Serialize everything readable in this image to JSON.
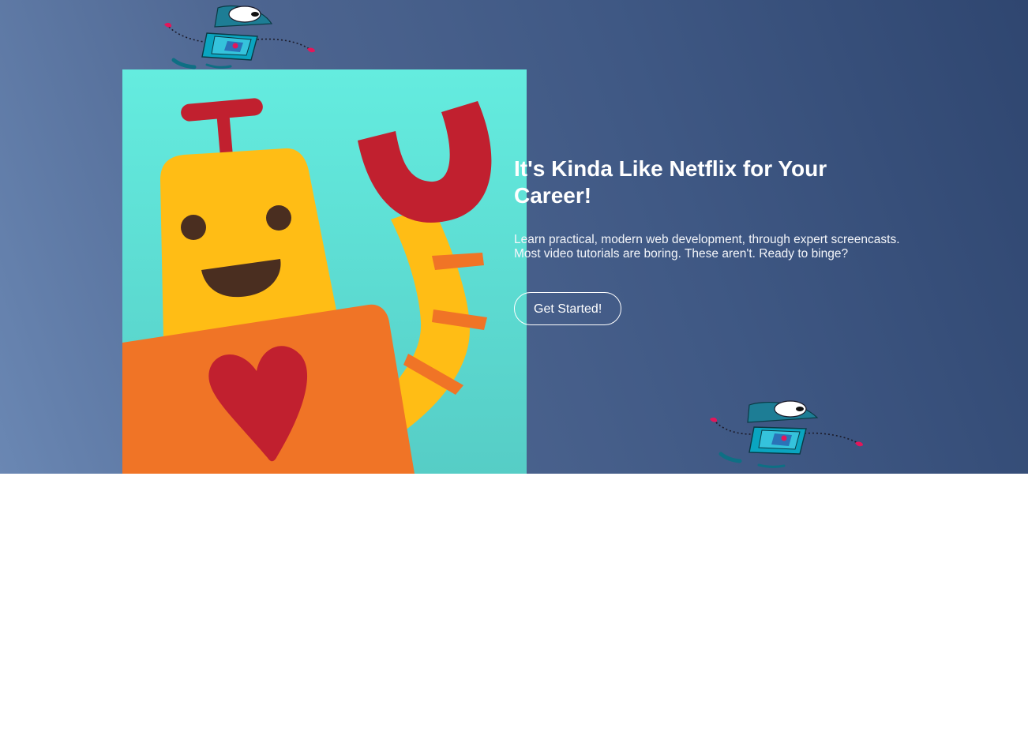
{
  "hero": {
    "title": "It's Kinda Like Netflix for Your Career!",
    "description": "Learn practical, modern web development, through expert screencasts. Most video tutorials are boring. These aren't. Ready to binge?",
    "cta_label": "Get Started!",
    "background_colors": [
      "#6a87b3",
      "#4d6590",
      "#2f4670"
    ]
  },
  "illustration": {
    "name": "waving-robot-illustration",
    "colors": {
      "background": "#62e9dd",
      "robot_head": "#ffbd15",
      "robot_body": "#f07426",
      "magnet": "#c1202f",
      "heart": "#c1202f",
      "eyes": "#4a2e20"
    }
  },
  "mascots": [
    {
      "name": "flying-mascot-top"
    },
    {
      "name": "flying-mascot-bottom"
    }
  ]
}
